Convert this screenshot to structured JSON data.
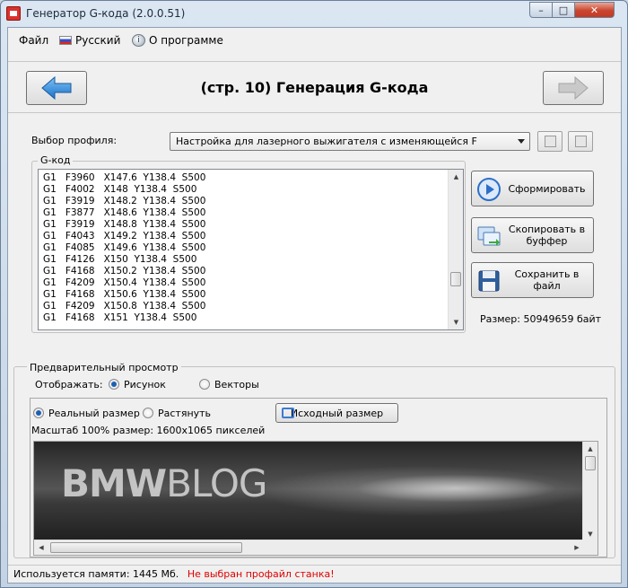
{
  "window": {
    "title": "Генератор G-кода (2.0.0.51)"
  },
  "menu": {
    "file": "Файл",
    "language": "Русский",
    "about": "О программе"
  },
  "header": {
    "page_title": "(стр. 10) Генерация G-кода"
  },
  "profile": {
    "label": "Выбор профиля:",
    "selected": "Настройка для лазерного выжигателя с изменяющейся F"
  },
  "gcode": {
    "legend": "G-код",
    "lines": [
      "G1   F3960   X147.6  Y138.4  S500",
      "G1   F4002   X148  Y138.4  S500",
      "G1   F3919   X148.2  Y138.4  S500",
      "G1   F3877   X148.6  Y138.4  S500",
      "G1   F3919   X148.8  Y138.4  S500",
      "G1   F4043   X149.2  Y138.4  S500",
      "G1   F4085   X149.6  Y138.4  S500",
      "G1   F4126   X150  Y138.4  S500",
      "G1   F4168   X150.2  Y138.4  S500",
      "G1   F4209   X150.4  Y138.4  S500",
      "G1   F4168   X150.6  Y138.4  S500",
      "G1   F4209   X150.8  Y138.4  S500",
      "G1   F4168   X151  Y138.4  S500"
    ]
  },
  "actions": {
    "generate": "Сформировать",
    "copy": "Скопировать в буффер",
    "save": "Сохранить в файл",
    "size_label": "Размер:",
    "size_value": "50949659 байт"
  },
  "preview": {
    "legend": "Предварительный просмотр",
    "display_label": "Отображать:",
    "mode_picture": "Рисунок",
    "mode_vectors": "Векторы",
    "selected_mode": "picture",
    "real_size": "Реальный размер",
    "stretch": "Растянуть",
    "selected_scale": "real",
    "original_size_button": "Исходный размер",
    "scale_info": "Масштаб 100% размер: 1600x1065 пикселей",
    "watermark_bold": "BMW",
    "watermark_light": "BLOG"
  },
  "status": {
    "memory_label": "Используется памяти:",
    "memory_value": "1445",
    "memory_unit": "Мб.",
    "error": "Не выбран профайл станка!"
  }
}
